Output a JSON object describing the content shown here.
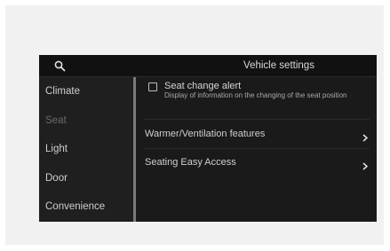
{
  "header": {
    "title": "Vehicle settings",
    "search_icon": "search-icon"
  },
  "sidebar": {
    "items": [
      {
        "label": "Climate",
        "selected": false
      },
      {
        "label": "Seat",
        "selected": true
      },
      {
        "label": "Light",
        "selected": false
      },
      {
        "label": "Door",
        "selected": false
      },
      {
        "label": "Convenience",
        "selected": false
      }
    ]
  },
  "seat_panel": {
    "seat_change_alert": {
      "label": "Seat change alert",
      "description": "Display of information on the changing of the seat position",
      "checked": false
    },
    "options": [
      {
        "label": "Warmer/Ventilation features",
        "icon": "chevron-right-icon"
      },
      {
        "label": "Seating Easy Access",
        "icon": "chevron-right-icon"
      }
    ]
  },
  "colors": {
    "screen_bg": "#1c1c1c",
    "text": "#cfcfcf",
    "selected_text": "#6a6a6a",
    "divider": "#7a7a7a"
  }
}
